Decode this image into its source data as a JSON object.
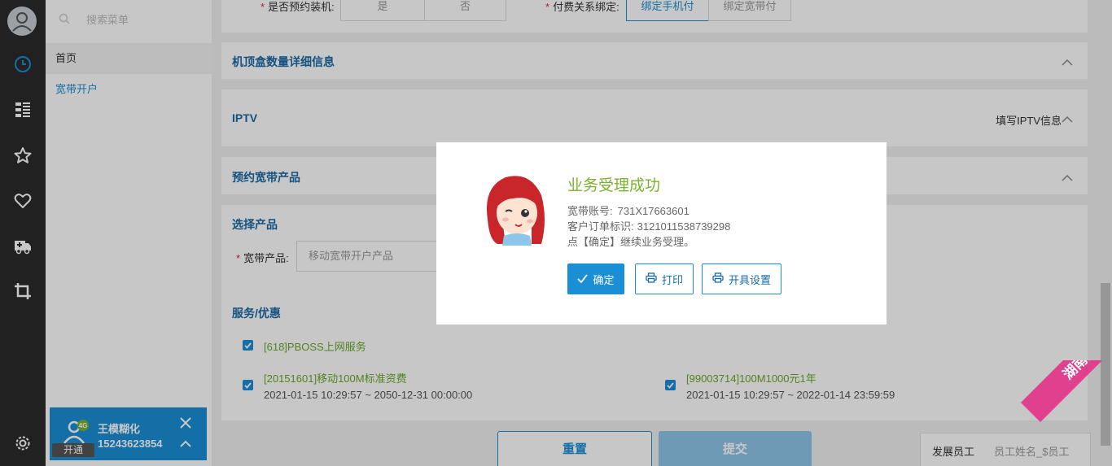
{
  "menu": {
    "search_placeholder": "搜索菜单",
    "items": [
      {
        "label": "首页"
      },
      {
        "label": "宽带开户"
      }
    ]
  },
  "user_card": {
    "name": "王模糊化",
    "phone": "15243623854",
    "status": "开通"
  },
  "form_top": {
    "reserve_label": "是否预约装机:",
    "reserve_options": [
      "是",
      "否"
    ],
    "payment_label": "付费关系绑定:",
    "payment_options": [
      "绑定手机付",
      "绑定宽带付"
    ],
    "payment_selected": "绑定手机付"
  },
  "sections": {
    "stb": {
      "title": "机顶盒数量详细信息"
    },
    "iptv": {
      "title": "IPTV",
      "hint": "填写IPTV信息"
    },
    "reserve_product": {
      "title": "预约宽带产品"
    },
    "select_product": {
      "title": "选择产品",
      "field_label": "宽带产品:",
      "field_placeholder": "移动宽带开户产品"
    },
    "services": {
      "title": "服务/优惠",
      "items": [
        {
          "name": "[618]PBOSS上网服务",
          "time": ""
        },
        {
          "name": "[20151601]移动100M标准资费",
          "time": "2021-01-15 10:29:57 ~ 2050-12-31 00:00:00"
        },
        {
          "name": "[99003714]100M1000元1年",
          "time": "2021-01-15 10:29:57 ~ 2022-01-14 23:59:59"
        }
      ]
    }
  },
  "actions": {
    "reset": "重置",
    "submit": "提交"
  },
  "developer": {
    "label": "发展员工",
    "value": "员工姓名_$员工"
  },
  "modal": {
    "title": "业务受理成功",
    "line1_label": "宽带账号:",
    "line1_value": "731X17663601",
    "line2_label": "客户订单标识:",
    "line2_value": "3121011538739298",
    "line3": "点【确定】继续业务受理。",
    "confirm": "确定",
    "print": "打印",
    "invoice_settings": "开具设置"
  },
  "ribbon": {
    "text": "湖南测试"
  },
  "colors": {
    "primary": "#1a8fd6",
    "success_green": "#7ab22e",
    "service_green": "#6aa82a",
    "ribbon_pink": "#e0408e",
    "rail_dark": "#2b2b2b"
  },
  "icons": [
    "user-avatar-icon",
    "clock-icon",
    "grid-list-icon",
    "star-icon",
    "heart-icon",
    "ambulance-icon",
    "crop-icon",
    "gear-icon",
    "search-icon",
    "close-icon",
    "chevron-up-icon",
    "check-icon",
    "printer-icon"
  ]
}
